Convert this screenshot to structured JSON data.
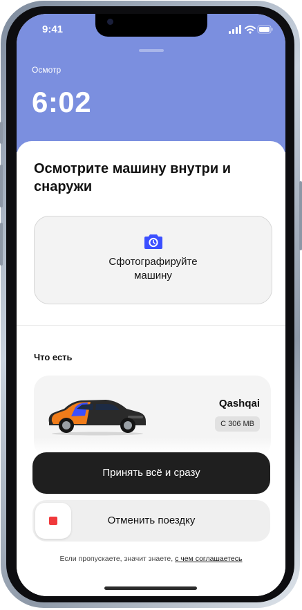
{
  "status_bar": {
    "time": "9:41"
  },
  "header": {
    "eyebrow": "Осмотр",
    "timer": "6:02"
  },
  "sheet": {
    "title": "Осмотрите машину внутри и снаружи",
    "photo_card": {
      "icon": "camera-icon",
      "label": "Сфотографируйте\nмашину"
    },
    "section_title": "Что есть",
    "car": {
      "name": "Qashqai",
      "plate": "С 306 МВ"
    }
  },
  "actions": {
    "accept_label": "Принять всё и сразу",
    "cancel_label": "Отменить поездку"
  },
  "footer": {
    "text": "Если пропускаете, значит знаете, ",
    "link": "с чем соглашаетесь"
  },
  "colors": {
    "hero": "#7b8fdf",
    "accent": "#3b4fff",
    "cancel_icon": "#f0393b",
    "primary_button": "#1f1f1f"
  }
}
